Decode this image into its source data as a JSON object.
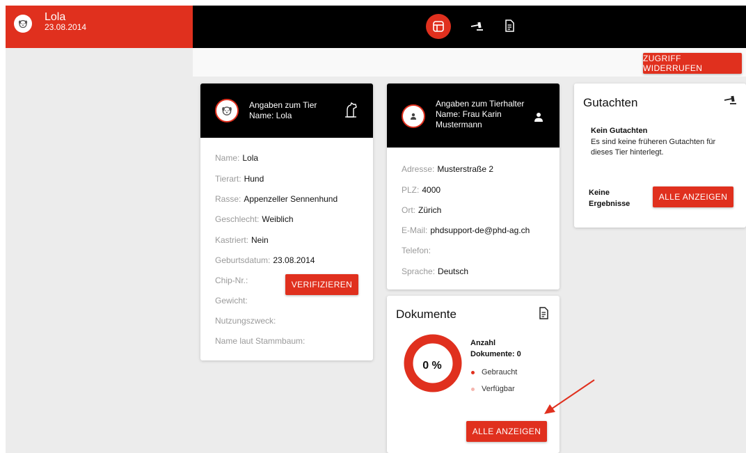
{
  "patient": {
    "name": "Lola",
    "birthdate": "23.08.2014"
  },
  "nav": {
    "items": [
      {
        "icon": "dashboard-icon",
        "active": true
      },
      {
        "icon": "hammer-icon",
        "active": false
      },
      {
        "icon": "document-icon",
        "active": false
      }
    ]
  },
  "actions": {
    "revoke_access": "ZUGRIFF WIDERRUFEN"
  },
  "animal_card": {
    "header_title": "Angaben zum Tier",
    "header_name": "Name: Lola",
    "fields": [
      {
        "label": "Name:",
        "value": "Lola"
      },
      {
        "label": "Tierart:",
        "value": "Hund"
      },
      {
        "label": "Rasse:",
        "value": "Appenzeller Sennenhund"
      },
      {
        "label": "Geschlecht:",
        "value": "Weiblich"
      },
      {
        "label": "Kastriert:",
        "value": "Nein"
      },
      {
        "label": "Geburtsdatum:",
        "value": "23.08.2014"
      },
      {
        "label": "Chip-Nr.:",
        "value": ""
      },
      {
        "label": "Gewicht:",
        "value": ""
      },
      {
        "label": "Nutzungszweck:",
        "value": ""
      },
      {
        "label": "Name laut Stammbaum:",
        "value": ""
      }
    ],
    "verify_label": "VERIFIZIEREN"
  },
  "owner_card": {
    "header_title": "Angaben zum Tierhalter",
    "header_name_line1": "Name: Frau Karin",
    "header_name_line2": "Mustermann",
    "fields": [
      {
        "label": "Adresse:",
        "value": "Musterstraße 2"
      },
      {
        "label": "PLZ:",
        "value": "4000"
      },
      {
        "label": "Ort:",
        "value": "Zürich"
      },
      {
        "label": "E-Mail:",
        "value": "phdsupport-de@phd-ag.ch"
      },
      {
        "label": "Telefon:",
        "value": ""
      },
      {
        "label": "Sprache:",
        "value": "Deutsch"
      }
    ]
  },
  "documents_card": {
    "title": "Dokumente",
    "percent_label": "0 %",
    "count_label_line1": "Anzahl",
    "count_label_line2": "Dokumente: 0",
    "legend": [
      {
        "label": "Gebraucht",
        "color": "#e0301e"
      },
      {
        "label": "Verfügbar",
        "color": "#f5b5ae"
      }
    ],
    "show_all": "ALLE ANZEIGEN",
    "used_fraction": 0
  },
  "expertise_card": {
    "title": "Gutachten",
    "empty_title": "Kein Gutachten",
    "empty_text": "Es sind keine früheren Gutachten für dieses Tier hinterlegt.",
    "no_results_line1": "Keine",
    "no_results_line2": "Ergebnisse",
    "show_all": "ALLE ANZEIGEN"
  },
  "colors": {
    "accent": "#e0301e",
    "header_bg": "#000000",
    "content_bg": "#ececec"
  }
}
